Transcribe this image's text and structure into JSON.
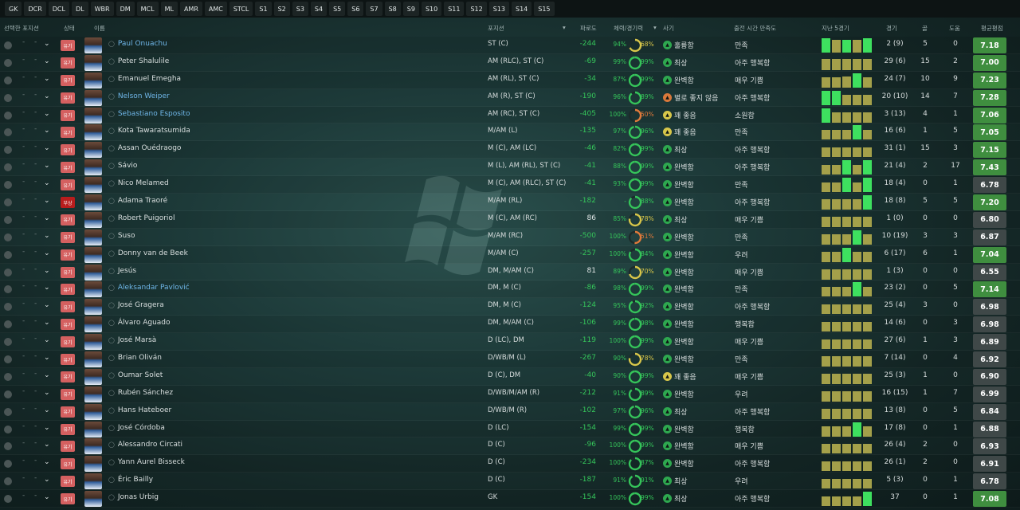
{
  "filters": [
    "GK",
    "DCR",
    "DCL",
    "DL",
    "WBR",
    "DM",
    "MCL",
    "ML",
    "AMR",
    "AMC",
    "STCL",
    "S1",
    "S2",
    "S3",
    "S4",
    "S5",
    "S6",
    "S7",
    "S8",
    "S9",
    "S10",
    "S11",
    "S12",
    "S13",
    "S14",
    "S15"
  ],
  "columns": {
    "select": "선택한 포지션",
    "status": "상태",
    "name": "이름",
    "position": "포지션",
    "familiarity": "파로도",
    "condition": "체력/경기력",
    "morale": "사기",
    "playing_time": "출전 시간 만족도",
    "form": "지난 5경기",
    "games": "경기",
    "goals": "골",
    "assists": "도움",
    "rating": "평균평점"
  },
  "colors": {
    "green": "#35c45a",
    "yellow": "#d7c64a",
    "orange": "#e07a3b",
    "status_red": "#d46060",
    "injured": "#b81d1d",
    "rating_green": "#3f8e3f",
    "rating_gray": "#3f4848"
  },
  "status_labels": {
    "normal": "유기",
    "injured": "부상"
  },
  "players": [
    {
      "name": "Paul Onuachu",
      "hl": true,
      "status": "normal",
      "position": "ST (C)",
      "fam": "-244",
      "fit": "94%",
      "fit_c": "g",
      "cond": "68%",
      "cond_c": "y",
      "morale": "훌륭함",
      "mor_c": "g",
      "satisfaction": "만족",
      "form": [
        [
          1,
          "g"
        ],
        [
          0.9,
          "y"
        ],
        [
          0.9,
          "g"
        ],
        [
          0.9,
          "y"
        ],
        [
          1,
          "g"
        ]
      ],
      "games": "2 (9)",
      "goals": "5",
      "assists": "0",
      "rating": "7.18",
      "rt_c": "g"
    },
    {
      "name": "Peter Shalulile",
      "hl": false,
      "status": "normal",
      "position": "AM (RLC), ST (C)",
      "fam": "-69",
      "fit": "99%",
      "fit_c": "g",
      "cond": "99%",
      "cond_c": "g",
      "morale": "최상",
      "mor_c": "g",
      "satisfaction": "아주 행복함",
      "form": [
        [
          0.75,
          "y"
        ],
        [
          0.75,
          "y"
        ],
        [
          0.75,
          "y"
        ],
        [
          0.75,
          "y"
        ],
        [
          0.75,
          "y"
        ]
      ],
      "games": "29 (6)",
      "goals": "15",
      "assists": "2",
      "rating": "7.00",
      "rt_c": "g"
    },
    {
      "name": "Emanuel Emegha",
      "hl": false,
      "status": "normal",
      "position": "AM (RL), ST (C)",
      "fam": "-34",
      "fit": "87%",
      "fit_c": "g",
      "cond": "99%",
      "cond_c": "g",
      "morale": "완벽함",
      "mor_c": "g",
      "satisfaction": "매우 기쁨",
      "form": [
        [
          0.7,
          "y"
        ],
        [
          0.7,
          "y"
        ],
        [
          0.75,
          "y"
        ],
        [
          1,
          "g"
        ],
        [
          0.7,
          "y"
        ]
      ],
      "games": "24 (7)",
      "goals": "10",
      "assists": "9",
      "rating": "7.23",
      "rt_c": "g"
    },
    {
      "name": "Nelson Weiper",
      "hl": true,
      "status": "normal",
      "position": "AM (R), ST (C)",
      "fam": "-190",
      "fit": "96%",
      "fit_c": "g",
      "cond": "89%",
      "cond_c": "g",
      "morale": "별로 좋지 않음",
      "mor_c": "o",
      "satisfaction": "아주 행복함",
      "form": [
        [
          1,
          "g"
        ],
        [
          1,
          "g"
        ],
        [
          0.7,
          "y"
        ],
        [
          0.7,
          "y"
        ],
        [
          0.7,
          "y"
        ]
      ],
      "games": "20 (10)",
      "goals": "14",
      "assists": "7",
      "rating": "7.28",
      "rt_c": "g"
    },
    {
      "name": "Sebastiano Esposito",
      "hl": true,
      "status": "normal",
      "position": "AM (RC), ST (C)",
      "fam": "-405",
      "fit": "100%",
      "fit_c": "g",
      "cond": "50%",
      "cond_c": "o",
      "morale": "꽤 좋음",
      "mor_c": "y",
      "satisfaction": "소원함",
      "form": [
        [
          1,
          "g"
        ],
        [
          0.7,
          "y"
        ],
        [
          0.7,
          "y"
        ],
        [
          0.7,
          "y"
        ],
        [
          0.7,
          "y"
        ]
      ],
      "games": "3 (13)",
      "goals": "4",
      "assists": "1",
      "rating": "7.06",
      "rt_c": "g"
    },
    {
      "name": "Kota Tawaratsumida",
      "hl": false,
      "status": "normal",
      "position": "M/AM (L)",
      "fam": "-135",
      "fit": "97%",
      "fit_c": "g",
      "cond": "96%",
      "cond_c": "g",
      "morale": "꽤 좋음",
      "mor_c": "y",
      "satisfaction": "만족",
      "form": [
        [
          0.7,
          "y"
        ],
        [
          0.7,
          "y"
        ],
        [
          0.7,
          "y"
        ],
        [
          1,
          "g"
        ],
        [
          0.7,
          "y"
        ]
      ],
      "games": "16 (6)",
      "goals": "1",
      "assists": "5",
      "rating": "7.05",
      "rt_c": "g"
    },
    {
      "name": "Assan Ouédraogo",
      "hl": false,
      "status": "normal",
      "position": "M (C), AM (LC)",
      "fam": "-46",
      "fit": "82%",
      "fit_c": "g",
      "cond": "99%",
      "cond_c": "g",
      "morale": "최상",
      "mor_c": "g",
      "satisfaction": "아주 행복함",
      "form": [
        [
          0.7,
          "y"
        ],
        [
          0.7,
          "y"
        ],
        [
          0.7,
          "y"
        ],
        [
          0.7,
          "y"
        ],
        [
          0.7,
          "y"
        ]
      ],
      "games": "31 (1)",
      "goals": "15",
      "assists": "3",
      "rating": "7.15",
      "rt_c": "g"
    },
    {
      "name": "Sávio",
      "hl": false,
      "status": "normal",
      "position": "M (L), AM (RL), ST (C)",
      "fam": "-41",
      "fit": "88%",
      "fit_c": "g",
      "cond": "99%",
      "cond_c": "g",
      "morale": "완벽함",
      "mor_c": "g",
      "satisfaction": "아주 행복함",
      "form": [
        [
          0.7,
          "y"
        ],
        [
          0.7,
          "y"
        ],
        [
          1,
          "g"
        ],
        [
          0.7,
          "y"
        ],
        [
          1,
          "g"
        ]
      ],
      "games": "21 (4)",
      "goals": "2",
      "assists": "17",
      "rating": "7.43",
      "rt_c": "g"
    },
    {
      "name": "Nico Melamed",
      "hl": false,
      "status": "normal",
      "position": "M (C), AM (RLC), ST (C)",
      "fam": "-41",
      "fit": "93%",
      "fit_c": "g",
      "cond": "99%",
      "cond_c": "g",
      "morale": "완벽함",
      "mor_c": "g",
      "satisfaction": "만족",
      "form": [
        [
          0.7,
          "y"
        ],
        [
          0.7,
          "y"
        ],
        [
          1,
          "g"
        ],
        [
          0.7,
          "y"
        ],
        [
          1,
          "g"
        ]
      ],
      "games": "18 (4)",
      "goals": "0",
      "assists": "1",
      "rating": "6.78",
      "rt_c": "n"
    },
    {
      "name": "Adama Traoré",
      "hl": false,
      "status": "injured",
      "position": "M/AM (RL)",
      "fam": "-182",
      "fit": "-",
      "fit_c": "g",
      "cond": "88%",
      "cond_c": "g",
      "morale": "완벽함",
      "mor_c": "g",
      "satisfaction": "아주 행복함",
      "form": [
        [
          0.7,
          "y"
        ],
        [
          0.7,
          "y"
        ],
        [
          0.7,
          "y"
        ],
        [
          0.7,
          "y"
        ],
        [
          1,
          "g"
        ]
      ],
      "games": "18 (8)",
      "goals": "5",
      "assists": "5",
      "rating": "7.20",
      "rt_c": "g"
    },
    {
      "name": "Robert Puigoriol",
      "hl": false,
      "status": "normal",
      "position": "M (C), AM (RC)",
      "fam": "86",
      "fit": "85%",
      "fit_c": "g",
      "cond": "78%",
      "cond_c": "y",
      "morale": "최상",
      "mor_c": "g",
      "satisfaction": "매우 기쁨",
      "form": [
        [
          0.7,
          "y"
        ],
        [
          0.7,
          "y"
        ],
        [
          0.7,
          "y"
        ],
        [
          0.7,
          "y"
        ],
        [
          0.7,
          "y"
        ]
      ],
      "games": "1 (0)",
      "goals": "0",
      "assists": "0",
      "rating": "6.80",
      "rt_c": "n"
    },
    {
      "name": "Suso",
      "hl": false,
      "status": "normal",
      "position": "M/AM (RC)",
      "fam": "-500",
      "fit": "100%",
      "fit_c": "g",
      "cond": "51%",
      "cond_c": "o",
      "morale": "완벽함",
      "mor_c": "g",
      "satisfaction": "만족",
      "form": [
        [
          0.7,
          "y"
        ],
        [
          0.7,
          "y"
        ],
        [
          0.7,
          "y"
        ],
        [
          1,
          "g"
        ],
        [
          0.7,
          "y"
        ]
      ],
      "games": "10 (19)",
      "goals": "3",
      "assists": "3",
      "rating": "6.87",
      "rt_c": "n"
    },
    {
      "name": "Donny van de Beek",
      "hl": false,
      "status": "normal",
      "position": "M/AM (C)",
      "fam": "-257",
      "fit": "100%",
      "fit_c": "g",
      "cond": "84%",
      "cond_c": "g",
      "morale": "완벽함",
      "mor_c": "g",
      "satisfaction": "우려",
      "form": [
        [
          0.7,
          "y"
        ],
        [
          0.7,
          "y"
        ],
        [
          1,
          "g"
        ],
        [
          0.7,
          "y"
        ],
        [
          0.7,
          "y"
        ]
      ],
      "games": "6 (17)",
      "goals": "6",
      "assists": "1",
      "rating": "7.04",
      "rt_c": "g"
    },
    {
      "name": "Jesús",
      "hl": false,
      "status": "normal",
      "position": "DM, M/AM (C)",
      "fam": "81",
      "fit": "89%",
      "fit_c": "g",
      "cond": "70%",
      "cond_c": "y",
      "morale": "완벽함",
      "mor_c": "g",
      "satisfaction": "매우 기쁨",
      "form": [
        [
          0.7,
          "y"
        ],
        [
          0.7,
          "y"
        ],
        [
          0.7,
          "y"
        ],
        [
          0.7,
          "y"
        ],
        [
          0.7,
          "y"
        ]
      ],
      "games": "1 (3)",
      "goals": "0",
      "assists": "0",
      "rating": "6.55",
      "rt_c": "n"
    },
    {
      "name": "Aleksandar Pavlović",
      "hl": true,
      "status": "normal",
      "position": "DM, M (C)",
      "fam": "-86",
      "fit": "98%",
      "fit_c": "g",
      "cond": "99%",
      "cond_c": "g",
      "morale": "완벽함",
      "mor_c": "g",
      "satisfaction": "만족",
      "form": [
        [
          0.7,
          "y"
        ],
        [
          0.7,
          "y"
        ],
        [
          0.7,
          "y"
        ],
        [
          1,
          "g"
        ],
        [
          0.7,
          "y"
        ]
      ],
      "games": "23 (2)",
      "goals": "0",
      "assists": "5",
      "rating": "7.14",
      "rt_c": "g"
    },
    {
      "name": "José Gragera",
      "hl": false,
      "status": "normal",
      "position": "DM, M (C)",
      "fam": "-124",
      "fit": "95%",
      "fit_c": "g",
      "cond": "92%",
      "cond_c": "g",
      "morale": "완벽함",
      "mor_c": "g",
      "satisfaction": "아주 행복함",
      "form": [
        [
          0.7,
          "y"
        ],
        [
          0.7,
          "y"
        ],
        [
          0.7,
          "y"
        ],
        [
          0.7,
          "y"
        ],
        [
          0.7,
          "y"
        ]
      ],
      "games": "25 (4)",
      "goals": "3",
      "assists": "0",
      "rating": "6.98",
      "rt_c": "n"
    },
    {
      "name": "Álvaro Aguado",
      "hl": false,
      "status": "normal",
      "position": "DM, M/AM (C)",
      "fam": "-106",
      "fit": "99%",
      "fit_c": "g",
      "cond": "98%",
      "cond_c": "g",
      "morale": "완벽함",
      "mor_c": "g",
      "satisfaction": "행복함",
      "form": [
        [
          0.7,
          "y"
        ],
        [
          0.7,
          "y"
        ],
        [
          0.7,
          "y"
        ],
        [
          0.7,
          "y"
        ],
        [
          0.7,
          "y"
        ]
      ],
      "games": "14 (6)",
      "goals": "0",
      "assists": "3",
      "rating": "6.98",
      "rt_c": "n"
    },
    {
      "name": "José Marsà",
      "hl": false,
      "status": "normal",
      "position": "D (LC), DM",
      "fam": "-119",
      "fit": "100%",
      "fit_c": "g",
      "cond": "99%",
      "cond_c": "g",
      "morale": "완벽함",
      "mor_c": "g",
      "satisfaction": "매우 기쁨",
      "form": [
        [
          0.7,
          "y"
        ],
        [
          0.7,
          "y"
        ],
        [
          0.7,
          "y"
        ],
        [
          0.7,
          "y"
        ],
        [
          0.7,
          "y"
        ]
      ],
      "games": "27 (6)",
      "goals": "1",
      "assists": "3",
      "rating": "6.89",
      "rt_c": "n"
    },
    {
      "name": "Brian Oliván",
      "hl": false,
      "status": "normal",
      "position": "D/WB/M (L)",
      "fam": "-267",
      "fit": "90%",
      "fit_c": "g",
      "cond": "78%",
      "cond_c": "y",
      "morale": "완벽함",
      "mor_c": "g",
      "satisfaction": "만족",
      "form": [
        [
          0.7,
          "y"
        ],
        [
          0.7,
          "y"
        ],
        [
          0.7,
          "y"
        ],
        [
          0.7,
          "y"
        ],
        [
          0.7,
          "y"
        ]
      ],
      "games": "7 (14)",
      "goals": "0",
      "assists": "4",
      "rating": "6.92",
      "rt_c": "n"
    },
    {
      "name": "Oumar Solet",
      "hl": false,
      "status": "normal",
      "position": "D (C), DM",
      "fam": "-40",
      "fit": "90%",
      "fit_c": "g",
      "cond": "99%",
      "cond_c": "g",
      "morale": "꽤 좋음",
      "mor_c": "y",
      "satisfaction": "매우 기쁨",
      "form": [
        [
          0.7,
          "y"
        ],
        [
          0.7,
          "y"
        ],
        [
          0.7,
          "y"
        ],
        [
          0.7,
          "y"
        ],
        [
          0.7,
          "y"
        ]
      ],
      "games": "25 (3)",
      "goals": "1",
      "assists": "0",
      "rating": "6.90",
      "rt_c": "n"
    },
    {
      "name": "Rubén Sánchez",
      "hl": false,
      "status": "normal",
      "position": "D/WB/M/AM (R)",
      "fam": "-212",
      "fit": "91%",
      "fit_c": "g",
      "cond": "89%",
      "cond_c": "g",
      "morale": "완벽함",
      "mor_c": "g",
      "satisfaction": "우려",
      "form": [
        [
          0.7,
          "y"
        ],
        [
          0.7,
          "y"
        ],
        [
          0.7,
          "y"
        ],
        [
          0.7,
          "y"
        ],
        [
          0.7,
          "y"
        ]
      ],
      "games": "16 (15)",
      "goals": "1",
      "assists": "7",
      "rating": "6.99",
      "rt_c": "n"
    },
    {
      "name": "Hans Hateboer",
      "hl": false,
      "status": "normal",
      "position": "D/WB/M (R)",
      "fam": "-102",
      "fit": "97%",
      "fit_c": "g",
      "cond": "96%",
      "cond_c": "g",
      "morale": "최상",
      "mor_c": "g",
      "satisfaction": "아주 행복함",
      "form": [
        [
          0.7,
          "y"
        ],
        [
          0.7,
          "y"
        ],
        [
          0.7,
          "y"
        ],
        [
          0.7,
          "y"
        ],
        [
          0.7,
          "y"
        ]
      ],
      "games": "13 (8)",
      "goals": "0",
      "assists": "5",
      "rating": "6.84",
      "rt_c": "n"
    },
    {
      "name": "José Córdoba",
      "hl": false,
      "status": "normal",
      "position": "D (LC)",
      "fam": "-154",
      "fit": "99%",
      "fit_c": "g",
      "cond": "99%",
      "cond_c": "g",
      "morale": "완벽함",
      "mor_c": "g",
      "satisfaction": "행복함",
      "form": [
        [
          0.7,
          "y"
        ],
        [
          0.7,
          "y"
        ],
        [
          0.7,
          "y"
        ],
        [
          1,
          "g"
        ],
        [
          0.7,
          "y"
        ]
      ],
      "games": "17 (8)",
      "goals": "0",
      "assists": "1",
      "rating": "6.88",
      "rt_c": "n"
    },
    {
      "name": "Alessandro Circati",
      "hl": false,
      "status": "normal",
      "position": "D (C)",
      "fam": "-96",
      "fit": "100%",
      "fit_c": "g",
      "cond": "99%",
      "cond_c": "g",
      "morale": "완벽함",
      "mor_c": "g",
      "satisfaction": "매우 기쁨",
      "form": [
        [
          0.7,
          "y"
        ],
        [
          0.7,
          "y"
        ],
        [
          0.7,
          "y"
        ],
        [
          0.7,
          "y"
        ],
        [
          0.7,
          "y"
        ]
      ],
      "games": "26 (4)",
      "goals": "2",
      "assists": "0",
      "rating": "6.93",
      "rt_c": "n"
    },
    {
      "name": "Yann Aurel Bisseck",
      "hl": false,
      "status": "normal",
      "position": "D (C)",
      "fam": "-234",
      "fit": "100%",
      "fit_c": "g",
      "cond": "87%",
      "cond_c": "g",
      "morale": "완벽함",
      "mor_c": "g",
      "satisfaction": "아주 행복함",
      "form": [
        [
          0.7,
          "y"
        ],
        [
          0.7,
          "y"
        ],
        [
          0.7,
          "y"
        ],
        [
          0.7,
          "y"
        ],
        [
          0.7,
          "y"
        ]
      ],
      "games": "26 (1)",
      "goals": "2",
      "assists": "0",
      "rating": "6.91",
      "rt_c": "n"
    },
    {
      "name": "Éric Bailly",
      "hl": false,
      "status": "normal",
      "position": "D (C)",
      "fam": "-187",
      "fit": "91%",
      "fit_c": "g",
      "cond": "91%",
      "cond_c": "g",
      "morale": "최상",
      "mor_c": "g",
      "satisfaction": "우려",
      "form": [
        [
          0.7,
          "y"
        ],
        [
          0.7,
          "y"
        ],
        [
          0.7,
          "y"
        ],
        [
          0.7,
          "y"
        ],
        [
          0.7,
          "y"
        ]
      ],
      "games": "5 (3)",
      "goals": "0",
      "assists": "1",
      "rating": "6.78",
      "rt_c": "n"
    },
    {
      "name": "Jonas Urbig",
      "hl": false,
      "status": "normal",
      "position": "GK",
      "fam": "-154",
      "fit": "100%",
      "fit_c": "g",
      "cond": "99%",
      "cond_c": "g",
      "morale": "최상",
      "mor_c": "g",
      "satisfaction": "아주 행복함",
      "form": [
        [
          0.7,
          "y"
        ],
        [
          0.7,
          "y"
        ],
        [
          0.7,
          "y"
        ],
        [
          0.7,
          "y"
        ],
        [
          1,
          "g"
        ]
      ],
      "games": "37",
      "goals": "0",
      "assists": "1",
      "rating": "7.08",
      "rt_c": "g"
    }
  ]
}
